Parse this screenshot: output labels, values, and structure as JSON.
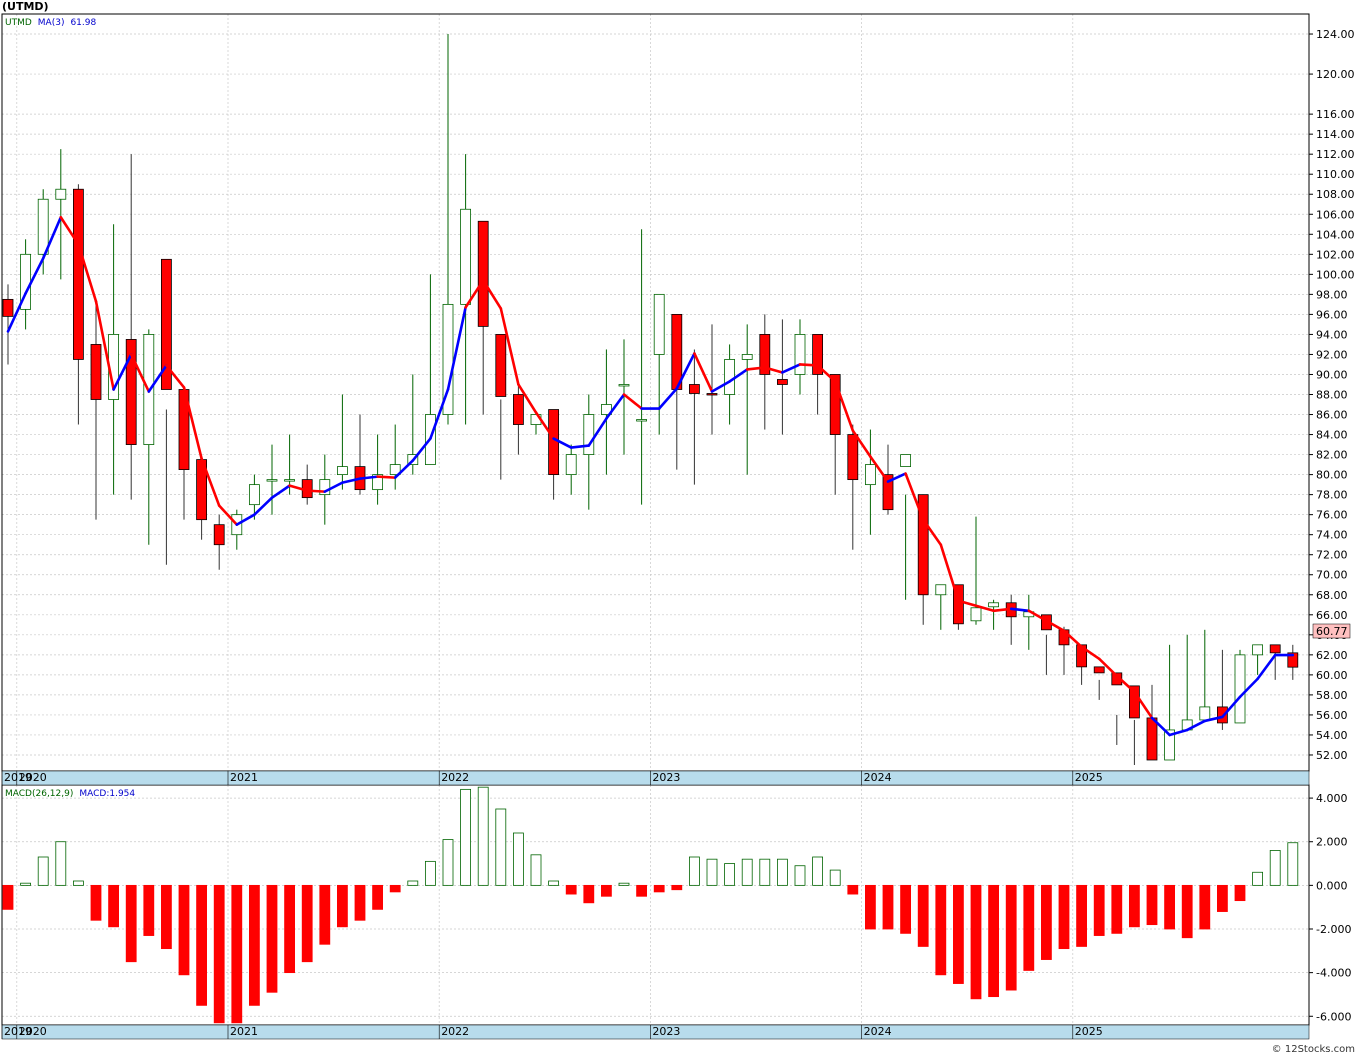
{
  "chart_data": [
    {
      "type": "candlestick",
      "title": "(UTMD)",
      "legend": {
        "symbol": "UTMD",
        "indicator": "MA(3)",
        "value": "61.98"
      },
      "last_price": "60.77",
      "watermark": "© 12Stocks.com",
      "year_labels": [
        "2019",
        "2020",
        "2021",
        "2022",
        "2023",
        "2024",
        "2025"
      ],
      "ylim": [
        50.4,
        126
      ],
      "yticks": [
        "52.00",
        "54.00",
        "56.00",
        "58.00",
        "60.00",
        "62.00",
        "64.00",
        "66.00",
        "68.00",
        "70.00",
        "72.00",
        "74.00",
        "76.00",
        "78.00",
        "80.00",
        "82.00",
        "84.00",
        "86.00",
        "88.00",
        "90.00",
        "92.00",
        "94.00",
        "96.00",
        "98.00",
        "100.00",
        "102.00",
        "104.00",
        "106.00",
        "108.00",
        "110.00",
        "112.00",
        "114.00",
        "116.00",
        "120.00",
        "124.00"
      ],
      "colors": {
        "up": "#ffffff",
        "up_border": "#006400",
        "down": "#ff0000",
        "down_border": "#000000",
        "ma_up": "#0000ff",
        "ma_down": "#ff0000"
      },
      "x": [
        "2019-12",
        "2020-01",
        "2020-02",
        "2020-03",
        "2020-04",
        "2020-05",
        "2020-06",
        "2020-07",
        "2020-08",
        "2020-09",
        "2020-10",
        "2020-11",
        "2020-12",
        "2021-01",
        "2021-02",
        "2021-03",
        "2021-04",
        "2021-05",
        "2021-06",
        "2021-07",
        "2021-08",
        "2021-09",
        "2021-10",
        "2021-11",
        "2021-12",
        "2022-01",
        "2022-02",
        "2022-03",
        "2022-04",
        "2022-05",
        "2022-06",
        "2022-07",
        "2022-08",
        "2022-09",
        "2022-10",
        "2022-11",
        "2022-12",
        "2023-01",
        "2023-02",
        "2023-03",
        "2023-04",
        "2023-05",
        "2023-06",
        "2023-07",
        "2023-08",
        "2023-09",
        "2023-10",
        "2023-11",
        "2023-12",
        "2024-01",
        "2024-02",
        "2024-03",
        "2024-04",
        "2024-05",
        "2024-06",
        "2024-07",
        "2024-08",
        "2024-09",
        "2024-10",
        "2024-11",
        "2024-12",
        "2025-01",
        "2025-02",
        "2025-03",
        "2025-04",
        "2025-05",
        "2025-06",
        "2025-07",
        "2025-08",
        "2025-09",
        "2025-10",
        "2025-11",
        "2025-12",
        "2026-01",
        "2026-02",
        "2026-03",
        "2026-04"
      ],
      "open": [
        97.5,
        96.5,
        102,
        107.5,
        108.5,
        93,
        87.5,
        93.5,
        83,
        101.5,
        88.5,
        81.5,
        75,
        74,
        77,
        79.5,
        79.5,
        79.5,
        78,
        80,
        80.8,
        78.5,
        80,
        81,
        81,
        86,
        97,
        105.3,
        94,
        88,
        85,
        86.5,
        80,
        82,
        86,
        89,
        85.5,
        92,
        96,
        89,
        88.1,
        88,
        91.5,
        94,
        89.5,
        90,
        94,
        90,
        84,
        79,
        80,
        80.8,
        78,
        68,
        69,
        65.4,
        66.8,
        67.2,
        65.8,
        66,
        64.5,
        63,
        60.8,
        60.2,
        58.9,
        55.7,
        51.5,
        54.5,
        55.5,
        56.8,
        55.2,
        62,
        63,
        62.2,
        60.77
      ],
      "close": [
        95.8,
        102,
        107.5,
        108.5,
        91.5,
        87.5,
        94,
        83,
        94,
        88.5,
        80.5,
        75.5,
        73,
        76,
        79,
        79.5,
        79.5,
        77.7,
        79.5,
        80.8,
        78.5,
        80,
        81,
        82,
        86,
        97,
        106.5,
        94.8,
        87.8,
        85,
        86,
        80,
        82,
        86,
        87,
        89,
        85.5,
        98,
        88.5,
        88.1,
        88,
        91.5,
        92,
        90,
        89,
        94,
        90,
        84,
        79.5,
        81,
        76.5,
        82,
        68,
        69,
        65.1,
        66.7,
        67.2,
        65.8,
        66.3,
        64.5,
        63,
        60.8,
        60.2,
        59,
        55.7,
        51.5,
        54.5,
        55.5,
        56.8,
        55.2,
        62,
        63,
        62.2,
        60.77,
        60.77
      ],
      "high": [
        99,
        103.5,
        108.5,
        112.5,
        109,
        97,
        105,
        112,
        94.5,
        86.5,
        80.5,
        78.5,
        76,
        76.5,
        80,
        83,
        84,
        81,
        82,
        88,
        86,
        84,
        85,
        90,
        100,
        124,
        112,
        95.5,
        87.5,
        89,
        86,
        81,
        83,
        88,
        92.5,
        93.5,
        104.5,
        98,
        94,
        92.5,
        95,
        93,
        95,
        96,
        95.5,
        95.5,
        94,
        85,
        85,
        84.5,
        83,
        78,
        70,
        69,
        68.8,
        75.8,
        67.5,
        68,
        68,
        64,
        64.8,
        61.7,
        59.5,
        56,
        55.5,
        59,
        63,
        64,
        64.5,
        62.5,
        62.5,
        63,
        63,
        63,
        62
      ],
      "low": [
        91,
        94.5,
        100,
        99.5,
        85,
        75.5,
        78,
        77.5,
        73,
        71,
        75.5,
        73.5,
        70.5,
        72.5,
        75.5,
        76,
        78,
        77,
        75,
        78.5,
        78,
        77,
        78.5,
        80,
        82,
        85,
        85,
        86,
        79.5,
        82,
        84,
        77.5,
        78,
        76.5,
        80,
        82,
        77,
        84,
        80.5,
        79,
        84,
        85,
        80,
        84.5,
        84,
        88,
        86,
        78,
        72.5,
        74,
        76,
        67.5,
        65,
        64.5,
        64.5,
        65,
        64.5,
        63,
        62.5,
        60,
        60,
        59,
        57.5,
        53,
        51,
        53,
        52,
        54.5,
        55.5,
        54.5,
        59.5,
        60,
        59.5,
        59.5,
        59.5
      ],
      "ma": [
        94.3,
        98.1,
        101.6,
        105.7,
        103,
        97.3,
        88.5,
        92,
        88.3,
        90.9,
        88.7,
        81.6,
        76.9,
        75,
        76,
        77.7,
        78.9,
        78.4,
        78.3,
        79.2,
        79.6,
        79.8,
        79.7,
        81.4,
        83.6,
        88.5,
        96.7,
        99.4,
        96.6,
        89,
        86.2,
        83.6,
        82.7,
        82.9,
        85.6,
        88,
        86.6,
        86.6,
        88.6,
        92.1,
        88.3,
        89.3,
        90.5,
        90.7,
        90.2,
        91,
        90.9,
        89.3,
        84.4,
        81.8,
        79.3,
        80.1,
        75.5,
        73,
        67.4,
        66.9,
        66.4,
        66.6,
        66.4,
        65.4,
        64.4,
        62.8,
        61.6,
        59.9,
        58.3,
        55.7,
        54,
        54.5,
        55.4,
        55.8,
        57.8,
        59.6,
        61.98,
        61.98,
        61.98
      ],
      "ma_color": [
        "blue",
        "blue",
        "blue",
        "blue",
        "red",
        "red",
        "red",
        "blue",
        "red",
        "blue",
        "red",
        "red",
        "red",
        "red",
        "blue",
        "blue",
        "blue",
        "red",
        "red",
        "blue",
        "blue",
        "blue",
        "red",
        "blue",
        "blue",
        "blue",
        "blue",
        "red",
        "red",
        "red",
        "red",
        "red",
        "blue",
        "blue",
        "blue",
        "blue",
        "red",
        "blue",
        "blue",
        "blue",
        "red",
        "blue",
        "blue",
        "red",
        "red",
        "blue",
        "red",
        "red",
        "red",
        "red",
        "red",
        "blue",
        "red",
        "red",
        "red",
        "red",
        "red",
        "red",
        "blue",
        "red",
        "red",
        "red",
        "red",
        "red",
        "red",
        "red",
        "blue",
        "blue",
        "blue",
        "blue",
        "blue",
        "blue",
        "blue",
        "blue",
        "blue"
      ]
    },
    {
      "type": "bar",
      "title": "MACD(26,12,9)",
      "legend": {
        "indicator": "MACD(26,12,9)",
        "label": "MACD:1.954"
      },
      "year_labels": [
        "2019",
        "2020",
        "2021",
        "2022",
        "2023",
        "2024",
        "2025"
      ],
      "ylim": [
        -6.4,
        4.6
      ],
      "yticks": [
        "-6.000",
        "-4.000",
        "-2.000",
        "0.000",
        "2.000",
        "4.000"
      ],
      "colors": {
        "positive_fill": "#ffffff",
        "positive_border": "#006400",
        "negative": "#ff0000"
      },
      "values": [
        -1.1,
        0.1,
        1.3,
        2.0,
        0.2,
        -1.6,
        -1.9,
        -3.5,
        -2.3,
        -2.9,
        -4.1,
        -5.5,
        -6.3,
        -6.3,
        -5.5,
        -4.9,
        -4.0,
        -3.5,
        -2.7,
        -1.9,
        -1.6,
        -1.1,
        -0.3,
        0.2,
        1.1,
        2.1,
        4.4,
        4.5,
        3.5,
        2.4,
        1.4,
        0.2,
        -0.4,
        -0.8,
        -0.5,
        0.1,
        -0.5,
        -0.3,
        -0.2,
        1.3,
        1.2,
        1.0,
        1.2,
        1.2,
        1.2,
        0.9,
        1.3,
        0.7,
        -0.4,
        -2.0,
        -2.0,
        -2.2,
        -2.8,
        -4.1,
        -4.5,
        -5.2,
        -5.1,
        -4.8,
        -3.9,
        -3.4,
        -2.9,
        -2.8,
        -2.3,
        -2.2,
        -1.9,
        -1.8,
        -2.0,
        -2.4,
        -2.0,
        -1.2,
        -0.7,
        0.6,
        1.6,
        1.954,
        1.954
      ]
    }
  ]
}
